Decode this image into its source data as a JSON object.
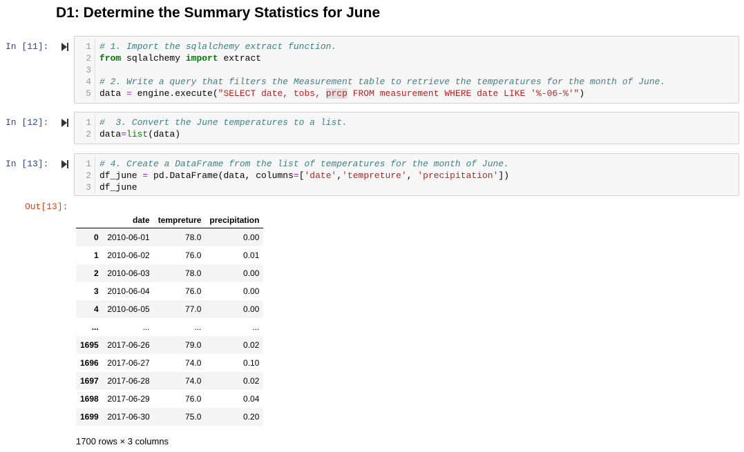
{
  "heading": "D1: Determine the Summary Statistics for June",
  "cells": [
    {
      "prompt": "In [11]:",
      "lines": [
        {
          "n": "1",
          "tokens": [
            {
              "t": "# 1. Import the sqlalchemy extract function.",
              "c": "cm-comment"
            }
          ]
        },
        {
          "n": "2",
          "tokens": [
            {
              "t": "from",
              "c": "cm-keyword"
            },
            {
              "t": " sqlalchemy ",
              "c": "cm-plain"
            },
            {
              "t": "import",
              "c": "cm-keyword"
            },
            {
              "t": " extract",
              "c": "cm-plain"
            }
          ]
        },
        {
          "n": "3",
          "tokens": []
        },
        {
          "n": "4",
          "tokens": [
            {
              "t": "# 2. Write a query that filters the Measurement table to retrieve the temperatures for the month of June.",
              "c": "cm-comment"
            }
          ]
        },
        {
          "n": "5",
          "tokens": [
            {
              "t": "data ",
              "c": "cm-plain"
            },
            {
              "t": "=",
              "c": "cm-op"
            },
            {
              "t": " engine.execute(",
              "c": "cm-plain"
            },
            {
              "t": "\"SELECT date, tobs, ",
              "c": "cm-string"
            },
            {
              "t": "prcp",
              "c": "cm-hl"
            },
            {
              "t": " FROM measurement WHERE date LIKE '%-06-%'\"",
              "c": "cm-string"
            },
            {
              "t": ")",
              "c": "cm-plain"
            }
          ]
        }
      ]
    },
    {
      "prompt": "In [12]:",
      "lines": [
        {
          "n": "1",
          "tokens": [
            {
              "t": "#  3. Convert the June temperatures to a list.",
              "c": "cm-comment"
            }
          ]
        },
        {
          "n": "2",
          "tokens": [
            {
              "t": "data",
              "c": "cm-plain"
            },
            {
              "t": "=",
              "c": "cm-op"
            },
            {
              "t": "list",
              "c": "cm-builtin"
            },
            {
              "t": "(data)",
              "c": "cm-plain"
            }
          ]
        }
      ]
    },
    {
      "prompt": "In [13]:",
      "lines": [
        {
          "n": "1",
          "tokens": [
            {
              "t": "# 4. Create a DataFrame from the list of temperatures for the month of June.",
              "c": "cm-comment"
            }
          ]
        },
        {
          "n": "2",
          "tokens": [
            {
              "t": "df_june ",
              "c": "cm-plain"
            },
            {
              "t": "=",
              "c": "cm-op"
            },
            {
              "t": " pd.DataFrame(data, columns",
              "c": "cm-plain"
            },
            {
              "t": "=",
              "c": "cm-op"
            },
            {
              "t": "[",
              "c": "cm-plain"
            },
            {
              "t": "'date'",
              "c": "cm-string"
            },
            {
              "t": ",",
              "c": "cm-plain"
            },
            {
              "t": "'tempreture'",
              "c": "cm-string"
            },
            {
              "t": ", ",
              "c": "cm-plain"
            },
            {
              "t": "'precipitation'",
              "c": "cm-string"
            },
            {
              "t": "])",
              "c": "cm-plain"
            }
          ]
        },
        {
          "n": "3",
          "tokens": [
            {
              "t": "df_june",
              "c": "cm-plain"
            }
          ]
        }
      ]
    }
  ],
  "output": {
    "prompt": "Out[13]:",
    "columns": [
      "",
      "date",
      "tempreture",
      "precipitation"
    ],
    "rows": [
      [
        "0",
        "2010-06-01",
        "78.0",
        "0.00"
      ],
      [
        "1",
        "2010-06-02",
        "76.0",
        "0.01"
      ],
      [
        "2",
        "2010-06-03",
        "78.0",
        "0.00"
      ],
      [
        "3",
        "2010-06-04",
        "76.0",
        "0.00"
      ],
      [
        "4",
        "2010-06-05",
        "77.0",
        "0.00"
      ],
      [
        "...",
        "...",
        "...",
        "..."
      ],
      [
        "1695",
        "2017-06-26",
        "79.0",
        "0.02"
      ],
      [
        "1696",
        "2017-06-27",
        "74.0",
        "0.10"
      ],
      [
        "1697",
        "2017-06-28",
        "74.0",
        "0.02"
      ],
      [
        "1698",
        "2017-06-29",
        "76.0",
        "0.04"
      ],
      [
        "1699",
        "2017-06-30",
        "75.0",
        "0.20"
      ]
    ],
    "summary": "1700 rows × 3 columns"
  }
}
